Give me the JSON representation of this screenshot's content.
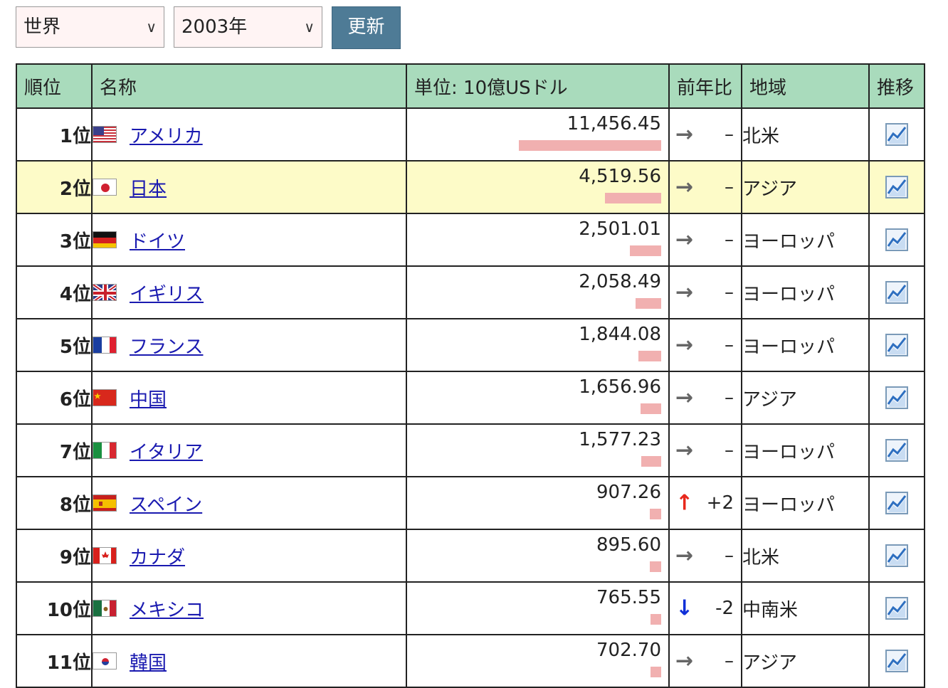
{
  "filters": {
    "region": "世界",
    "year": "2003年",
    "update_label": "更新"
  },
  "table": {
    "headers": {
      "rank": "順位",
      "name": "名称",
      "value": "単位: 10億USドル",
      "yoy": "前年比",
      "region": "地域",
      "trend": "推移"
    },
    "rows": [
      {
        "rank": "1位",
        "name": "アメリカ",
        "flag": "us-flag-icon",
        "value": "11,456.45",
        "bar_fraction": 1.0,
        "trend": "same",
        "delta": "–",
        "region": "北米",
        "highlight": false
      },
      {
        "rank": "2位",
        "name": "日本",
        "flag": "japan-flag-icon",
        "value": "4,519.56",
        "bar_fraction": 0.395,
        "trend": "same",
        "delta": "–",
        "region": "アジア",
        "highlight": true
      },
      {
        "rank": "3位",
        "name": "ドイツ",
        "flag": "germany-flag-icon",
        "value": "2,501.01",
        "bar_fraction": 0.218,
        "trend": "same",
        "delta": "–",
        "region": "ヨーロッパ",
        "highlight": false
      },
      {
        "rank": "4位",
        "name": "イギリス",
        "flag": "uk-flag-icon",
        "value": "2,058.49",
        "bar_fraction": 0.18,
        "trend": "same",
        "delta": "–",
        "region": "ヨーロッパ",
        "highlight": false
      },
      {
        "rank": "5位",
        "name": "フランス",
        "flag": "france-flag-icon",
        "value": "1,844.08",
        "bar_fraction": 0.161,
        "trend": "same",
        "delta": "–",
        "region": "ヨーロッパ",
        "highlight": false
      },
      {
        "rank": "6位",
        "name": "中国",
        "flag": "china-flag-icon",
        "value": "1,656.96",
        "bar_fraction": 0.145,
        "trend": "same",
        "delta": "–",
        "region": "アジア",
        "highlight": false
      },
      {
        "rank": "7位",
        "name": "イタリア",
        "flag": "italy-flag-icon",
        "value": "1,577.23",
        "bar_fraction": 0.138,
        "trend": "same",
        "delta": "–",
        "region": "ヨーロッパ",
        "highlight": false
      },
      {
        "rank": "8位",
        "name": "スペイン",
        "flag": "spain-flag-icon",
        "value": "907.26",
        "bar_fraction": 0.079,
        "trend": "up",
        "delta": "+2",
        "region": "ヨーロッパ",
        "highlight": false
      },
      {
        "rank": "9位",
        "name": "カナダ",
        "flag": "canada-flag-icon",
        "value": "895.60",
        "bar_fraction": 0.078,
        "trend": "same",
        "delta": "–",
        "region": "北米",
        "highlight": false
      },
      {
        "rank": "10位",
        "name": "メキシコ",
        "flag": "mexico-flag-icon",
        "value": "765.55",
        "bar_fraction": 0.067,
        "trend": "down",
        "delta": "-2",
        "region": "中南米",
        "highlight": false
      },
      {
        "rank": "11位",
        "name": "韓国",
        "flag": "korea-flag-icon",
        "value": "702.70",
        "bar_fraction": 0.061,
        "trend": "same",
        "delta": "–",
        "region": "アジア",
        "highlight": false
      }
    ]
  },
  "colors": {
    "header_bg": "#a9dbbc",
    "highlight_bg": "#fdfbc8",
    "bar": "#f1b0b0",
    "button": "#4e7b96",
    "arrow_up": "#e8281c",
    "arrow_down": "#1030d8"
  }
}
